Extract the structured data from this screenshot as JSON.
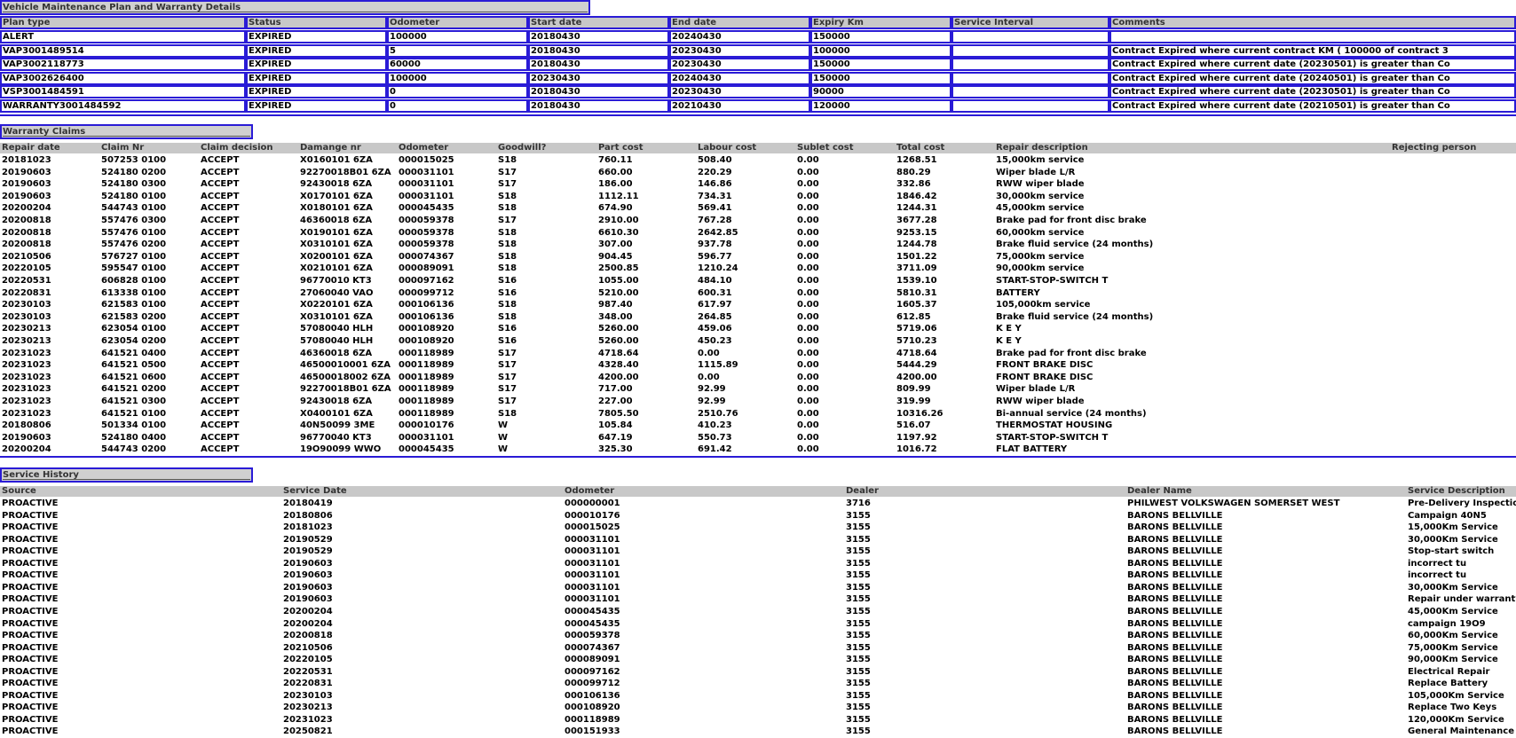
{
  "plan": {
    "title": "Vehicle Maintenance Plan and Warranty Details",
    "headers": [
      "Plan type",
      "Status",
      "Odometer",
      "Start date",
      "End date",
      "Expiry Km",
      "Service Interval",
      "Comments"
    ],
    "rows": [
      [
        "ALERT",
        "EXPIRED",
        "100000",
        "20180430",
        "20240430",
        "150000",
        "",
        ""
      ],
      [
        "VAP3001489514",
        "EXPIRED",
        "5",
        "20180430",
        "20230430",
        "100000",
        "",
        "Contract Expired where current contract KM ( 100000 of contract 3"
      ],
      [
        "VAP3002118773",
        "EXPIRED",
        "60000",
        "20180430",
        "20230430",
        "150000",
        "",
        "Contract Expired where current date (20230501) is greater than Co"
      ],
      [
        "VAP3002626400",
        "EXPIRED",
        "100000",
        "20230430",
        "20240430",
        "150000",
        "",
        "Contract Expired where current date (20240501) is greater than Co"
      ],
      [
        "VSP3001484591",
        "EXPIRED",
        "0",
        "20180430",
        "20230430",
        "90000",
        "",
        "Contract Expired where current date (20230501) is greater than Co"
      ],
      [
        "WARRANTY3001484592",
        "EXPIRED",
        "0",
        "20180430",
        "20210430",
        "120000",
        "",
        "Contract Expired where current date (20210501) is greater than Co"
      ]
    ]
  },
  "claims": {
    "title": "Warranty Claims",
    "headers": [
      "Repair date",
      "Claim Nr",
      "Claim decision",
      "Damange nr",
      "Odometer",
      "Goodwill?",
      "Part cost",
      "Labour cost",
      "Sublet cost",
      "Total cost",
      "Repair description",
      "Rejecting person"
    ],
    "rows": [
      [
        "20181023",
        "507253 0100",
        "ACCEPT",
        "X0160101 6ZA",
        "000015025",
        "S18",
        "760.11",
        "508.40",
        "0.00",
        "1268.51",
        "15,000km service",
        ""
      ],
      [
        "20190603",
        "524180 0200",
        "ACCEPT",
        "92270018B01 6ZA",
        "000031101",
        "S17",
        "660.00",
        "220.29",
        "0.00",
        "880.29",
        "Wiper blade L/R",
        ""
      ],
      [
        "20190603",
        "524180 0300",
        "ACCEPT",
        "92430018 6ZA",
        "000031101",
        "S17",
        "186.00",
        "146.86",
        "0.00",
        "332.86",
        "RWW wiper blade",
        ""
      ],
      [
        "20190603",
        "524180 0100",
        "ACCEPT",
        "X0170101 6ZA",
        "000031101",
        "S18",
        "1112.11",
        "734.31",
        "0.00",
        "1846.42",
        "30,000km service",
        ""
      ],
      [
        "20200204",
        "544743 0100",
        "ACCEPT",
        "X0180101 6ZA",
        "000045435",
        "S18",
        "674.90",
        "569.41",
        "0.00",
        "1244.31",
        "45,000km service",
        ""
      ],
      [
        "20200818",
        "557476 0300",
        "ACCEPT",
        "46360018 6ZA",
        "000059378",
        "S17",
        "2910.00",
        "767.28",
        "0.00",
        "3677.28",
        "Brake pad for front disc brake",
        ""
      ],
      [
        "20200818",
        "557476 0100",
        "ACCEPT",
        "X0190101 6ZA",
        "000059378",
        "S18",
        "6610.30",
        "2642.85",
        "0.00",
        "9253.15",
        "60,000km service",
        ""
      ],
      [
        "20200818",
        "557476 0200",
        "ACCEPT",
        "X0310101 6ZA",
        "000059378",
        "S18",
        "307.00",
        "937.78",
        "0.00",
        "1244.78",
        "Brake fluid service (24 months)",
        ""
      ],
      [
        "20210506",
        "576727 0100",
        "ACCEPT",
        "X0200101 6ZA",
        "000074367",
        "S18",
        "904.45",
        "596.77",
        "0.00",
        "1501.22",
        "75,000km service",
        ""
      ],
      [
        "20220105",
        "595547 0100",
        "ACCEPT",
        "X0210101 6ZA",
        "000089091",
        "S18",
        "2500.85",
        "1210.24",
        "0.00",
        "3711.09",
        "90,000km service",
        ""
      ],
      [
        "20220531",
        "606828 0100",
        "ACCEPT",
        "96770010 KT3",
        "000097162",
        "S16",
        "1055.00",
        "484.10",
        "0.00",
        "1539.10",
        "START-STOP-SWITCH T",
        ""
      ],
      [
        "20220831",
        "613338 0100",
        "ACCEPT",
        "27060040 VAO",
        "000099712",
        "S16",
        "5210.00",
        "600.31",
        "0.00",
        "5810.31",
        "BATTERY",
        ""
      ],
      [
        "20230103",
        "621583 0100",
        "ACCEPT",
        "X0220101 6ZA",
        "000106136",
        "S18",
        "987.40",
        "617.97",
        "0.00",
        "1605.37",
        "105,000km service",
        ""
      ],
      [
        "20230103",
        "621583 0200",
        "ACCEPT",
        "X0310101 6ZA",
        "000106136",
        "S18",
        "348.00",
        "264.85",
        "0.00",
        "612.85",
        "Brake fluid service (24 months)",
        ""
      ],
      [
        "20230213",
        "623054 0100",
        "ACCEPT",
        "57080040 HLH",
        "000108920",
        "S16",
        "5260.00",
        "459.06",
        "0.00",
        "5719.06",
        "K E Y",
        ""
      ],
      [
        "20230213",
        "623054 0200",
        "ACCEPT",
        "57080040 HLH",
        "000108920",
        "S16",
        "5260.00",
        "450.23",
        "0.00",
        "5710.23",
        "K E Y",
        ""
      ],
      [
        "20231023",
        "641521 0400",
        "ACCEPT",
        "46360018 6ZA",
        "000118989",
        "S17",
        "4718.64",
        "0.00",
        "0.00",
        "4718.64",
        "Brake pad for front disc brake",
        ""
      ],
      [
        "20231023",
        "641521 0500",
        "ACCEPT",
        "46500010001 6ZA",
        "000118989",
        "S17",
        "4328.40",
        "1115.89",
        "0.00",
        "5444.29",
        "FRONT BRAKE DISC",
        ""
      ],
      [
        "20231023",
        "641521 0600",
        "ACCEPT",
        "46500018002 6ZA",
        "000118989",
        "S17",
        "4200.00",
        "0.00",
        "0.00",
        "4200.00",
        "FRONT BRAKE DISC",
        ""
      ],
      [
        "20231023",
        "641521 0200",
        "ACCEPT",
        "92270018B01 6ZA",
        "000118989",
        "S17",
        "717.00",
        "92.99",
        "0.00",
        "809.99",
        "Wiper blade L/R",
        ""
      ],
      [
        "20231023",
        "641521 0300",
        "ACCEPT",
        "92430018 6ZA",
        "000118989",
        "S17",
        "227.00",
        "92.99",
        "0.00",
        "319.99",
        "RWW wiper blade",
        ""
      ],
      [
        "20231023",
        "641521 0100",
        "ACCEPT",
        "X0400101 6ZA",
        "000118989",
        "S18",
        "7805.50",
        "2510.76",
        "0.00",
        "10316.26",
        "Bi-annual service (24 months)",
        ""
      ],
      [
        "20180806",
        "501334 0100",
        "ACCEPT",
        "40N50099 3ME",
        "000010176",
        "W",
        "105.84",
        "410.23",
        "0.00",
        "516.07",
        "THERMOSTAT HOUSING",
        ""
      ],
      [
        "20190603",
        "524180 0400",
        "ACCEPT",
        "96770040 KT3",
        "000031101",
        "W",
        "647.19",
        "550.73",
        "0.00",
        "1197.92",
        "START-STOP-SWITCH T",
        ""
      ],
      [
        "20200204",
        "544743 0200",
        "ACCEPT",
        "19O90099 WWO",
        "000045435",
        "W",
        "325.30",
        "691.42",
        "0.00",
        "1016.72",
        "FLAT BATTERY",
        ""
      ]
    ]
  },
  "history": {
    "title": "Service History",
    "headers": [
      "Source",
      "Service Date",
      "Odometer",
      "Dealer",
      "Dealer Name",
      "Service Description"
    ],
    "rows": [
      [
        "PROACTIVE",
        "20180419",
        "000000001",
        "3716",
        "PHILWEST VOLKSWAGEN SOMERSET WEST",
        "Pre-Delivery Inspection"
      ],
      [
        "PROACTIVE",
        "20180806",
        "000010176",
        "3155",
        "BARONS BELLVILLE",
        "Campaign 40N5"
      ],
      [
        "PROACTIVE",
        "20181023",
        "000015025",
        "3155",
        "BARONS BELLVILLE",
        "15,000Km Service"
      ],
      [
        "PROACTIVE",
        "20190529",
        "000031101",
        "3155",
        "BARONS BELLVILLE",
        "30,000Km Service"
      ],
      [
        "PROACTIVE",
        "20190529",
        "000031101",
        "3155",
        "BARONS BELLVILLE",
        "Stop-start switch"
      ],
      [
        "PROACTIVE",
        "20190603",
        "000031101",
        "3155",
        "BARONS BELLVILLE",
        "incorrect tu"
      ],
      [
        "PROACTIVE",
        "20190603",
        "000031101",
        "3155",
        "BARONS BELLVILLE",
        "incorrect tu"
      ],
      [
        "PROACTIVE",
        "20190603",
        "000031101",
        "3155",
        "BARONS BELLVILLE",
        "30,000Km Service"
      ],
      [
        "PROACTIVE",
        "20190603",
        "000031101",
        "3155",
        "BARONS BELLVILLE",
        "Repair under warranty"
      ],
      [
        "PROACTIVE",
        "20200204",
        "000045435",
        "3155",
        "BARONS BELLVILLE",
        "45,000Km Service"
      ],
      [
        "PROACTIVE",
        "20200204",
        "000045435",
        "3155",
        "BARONS BELLVILLE",
        "campaign 19O9"
      ],
      [
        "PROACTIVE",
        "20200818",
        "000059378",
        "3155",
        "BARONS BELLVILLE",
        "60,000Km Service"
      ],
      [
        "PROACTIVE",
        "20210506",
        "000074367",
        "3155",
        "BARONS BELLVILLE",
        "75,000Km Service"
      ],
      [
        "PROACTIVE",
        "20220105",
        "000089091",
        "3155",
        "BARONS BELLVILLE",
        "90,000Km Service"
      ],
      [
        "PROACTIVE",
        "20220531",
        "000097162",
        "3155",
        "BARONS BELLVILLE",
        "Electrical Repair"
      ],
      [
        "PROACTIVE",
        "20220831",
        "000099712",
        "3155",
        "BARONS BELLVILLE",
        "Replace Battery"
      ],
      [
        "PROACTIVE",
        "20230103",
        "000106136",
        "3155",
        "BARONS BELLVILLE",
        "105,000Km Service"
      ],
      [
        "PROACTIVE",
        "20230213",
        "000108920",
        "3155",
        "BARONS BELLVILLE",
        "Replace Two Keys"
      ],
      [
        "PROACTIVE",
        "20231023",
        "000118989",
        "3155",
        "BARONS BELLVILLE",
        "120,000Km Service"
      ],
      [
        "PROACTIVE",
        "20250821",
        "000151933",
        "3155",
        "BARONS BELLVILLE",
        "General Maintenance"
      ]
    ]
  }
}
